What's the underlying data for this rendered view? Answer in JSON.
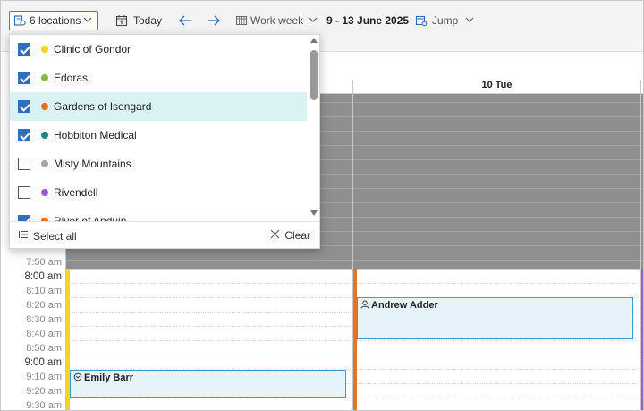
{
  "toolbar": {
    "locations_label": "6 locations",
    "today_label": "Today",
    "view_label": "Work week",
    "date_range": "9 - 13 June 2025",
    "jump_label": "Jump"
  },
  "calendar": {
    "day_header": "10 Tue",
    "time_labels": [
      {
        "label": "7:50 am",
        "hour": false
      },
      {
        "label": "8:00 am",
        "hour": true
      },
      {
        "label": "8:10 am",
        "hour": false
      },
      {
        "label": "8:20 am",
        "hour": false
      },
      {
        "label": "8:30 am",
        "hour": false
      },
      {
        "label": "8:40 am",
        "hour": false
      },
      {
        "label": "8:50 am",
        "hour": false
      },
      {
        "label": "9:00 am",
        "hour": true
      },
      {
        "label": "9:10 am",
        "hour": false
      },
      {
        "label": "9:20 am",
        "hour": false
      },
      {
        "label": "9:30 am",
        "hour": false
      }
    ],
    "events": [
      {
        "name": "Andrew Adder",
        "icon": "person-icon"
      },
      {
        "name": "Emily Barr",
        "icon": "stethoscope-icon"
      }
    ],
    "stripe_colors": {
      "monday": "#f5d327",
      "tuesday": "#e8741e",
      "wednesday": "#9b59d0"
    }
  },
  "location_dropdown": {
    "items": [
      {
        "label": "Clinic of Gondor",
        "checked": true,
        "color": "#f5d327",
        "selected": false
      },
      {
        "label": "Edoras",
        "checked": true,
        "color": "#8bb54a",
        "selected": false
      },
      {
        "label": "Gardens of Isengard",
        "checked": true,
        "color": "#e8741e",
        "selected": true
      },
      {
        "label": "Hobbiton Medical",
        "checked": true,
        "color": "#1a8a80",
        "selected": false
      },
      {
        "label": "Misty Mountains",
        "checked": false,
        "color": "#a3a8b0",
        "selected": false
      },
      {
        "label": "Rivendell",
        "checked": false,
        "color": "#9b59d0",
        "selected": false
      },
      {
        "label": "River of Anduin",
        "checked": true,
        "color": "#e8741e",
        "selected": false
      }
    ],
    "select_all_label": "Select all",
    "clear_label": "Clear"
  }
}
